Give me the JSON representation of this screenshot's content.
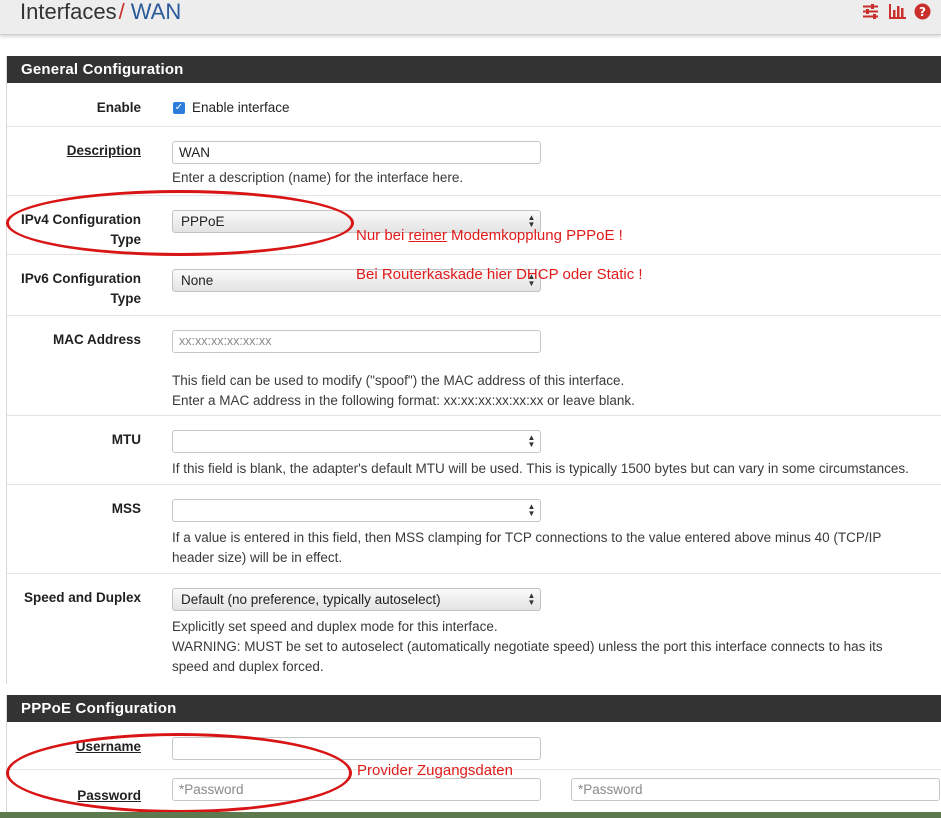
{
  "breadcrumb": {
    "parent": "Interfaces",
    "separator": "/",
    "current": "WAN"
  },
  "header_icons": [
    "sliders-icon",
    "chart-icon",
    "help-icon"
  ],
  "general": {
    "title": "General Configuration",
    "enable": {
      "label": "Enable",
      "checkbox_label": "Enable interface",
      "checked": true
    },
    "description": {
      "label": "Description",
      "value": "WAN",
      "help": "Enter a description (name) for the interface here."
    },
    "ipv4": {
      "label_line1": "IPv4 Configuration",
      "label_line2": "Type",
      "value": "PPPoE"
    },
    "ipv6": {
      "label_line1": "IPv6 Configuration",
      "label_line2": "Type",
      "value": "None"
    },
    "mac": {
      "label": "MAC Address",
      "placeholder": "xx:xx:xx:xx:xx:xx",
      "help_line1": "This field can be used to modify (\"spoof\") the MAC address of this interface.",
      "help_line2": "Enter a MAC address in the following format: xx:xx:xx:xx:xx:xx or leave blank."
    },
    "mtu": {
      "label": "MTU",
      "value": "",
      "help": "If this field is blank, the adapter's default MTU will be used. This is typically 1500 bytes but can vary in some circumstances."
    },
    "mss": {
      "label": "MSS",
      "value": "",
      "help_line1": "If a value is entered in this field, then MSS clamping for TCP connections to the value entered above minus 40 (TCP/IP",
      "help_line2": "header size) will be in effect."
    },
    "speed": {
      "label": "Speed and Duplex",
      "value": "Default (no preference, typically autoselect)",
      "help_line1": "Explicitly set speed and duplex mode for this interface.",
      "help_line2": "WARNING: MUST be set to autoselect (automatically negotiate speed) unless the port this interface connects to has its",
      "help_line3": "speed and duplex forced."
    }
  },
  "pppoe": {
    "title": "PPPoE Configuration",
    "username": {
      "label": "Username",
      "value": ""
    },
    "password": {
      "label": "Password",
      "placeholder": "*Password",
      "confirm_placeholder": "*Password"
    }
  },
  "annotations": {
    "ipv4_note_before": "Nur bei ",
    "ipv4_note_underlined": "reiner",
    "ipv4_note_after": " Modemkopplung PPPoE !",
    "cascade_note": "Bei Routerkaskade hier DHCP oder Static !",
    "provider_note": "Provider Zugangsdaten"
  },
  "colors": {
    "panel_header": "#333333",
    "annotation": "#e01b1b",
    "link": "#2a5a9a",
    "checkbox": "#2f7ddb"
  }
}
